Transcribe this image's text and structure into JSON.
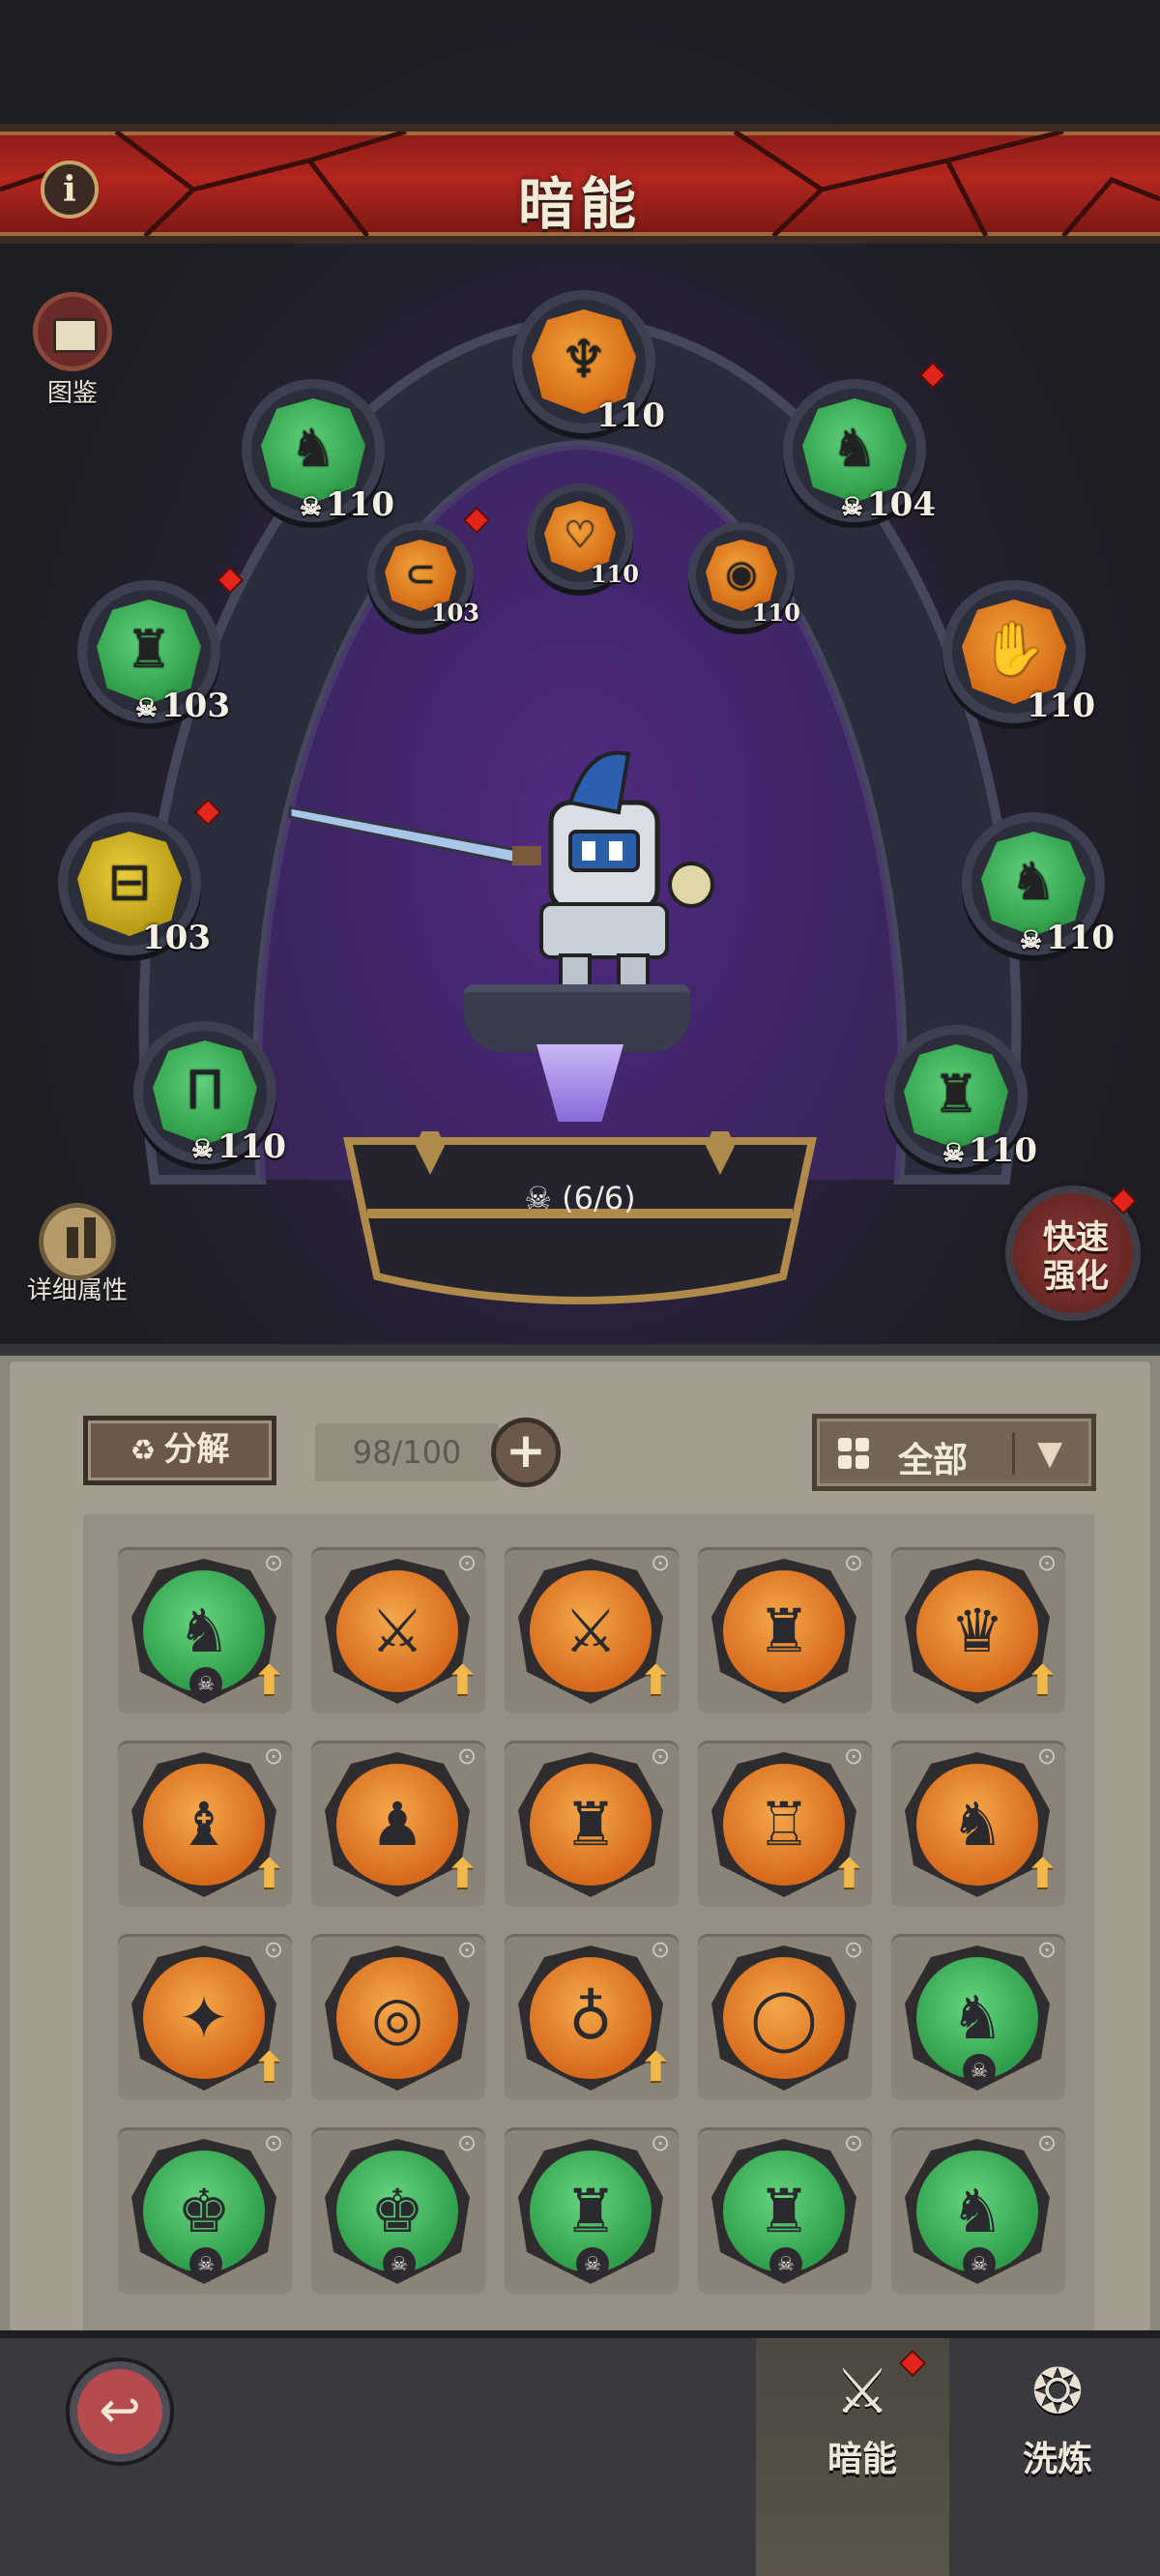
{
  "header": {
    "title": "暗能",
    "info_icon": "i"
  },
  "side_buttons": {
    "codex_label": "图鉴",
    "detail_label": "详细属性",
    "quick_label_line1": "快速",
    "quick_label_line2": "强化"
  },
  "equipped_slots": [
    {
      "name": "slot-top",
      "tier": "orange",
      "icon": "crossbow-icon",
      "level": "110",
      "has_skull": false
    },
    {
      "name": "slot-upper-left",
      "tier": "green",
      "icon": "helm-icon",
      "level": "110",
      "has_skull": true
    },
    {
      "name": "slot-upper-right",
      "tier": "green",
      "icon": "helm-icon",
      "level": "104",
      "has_skull": true
    },
    {
      "name": "slot-inner-left",
      "tier": "orange",
      "icon": "belt-icon",
      "level": "103",
      "has_skull": false
    },
    {
      "name": "slot-inner-center",
      "tier": "orange",
      "icon": "amulet-icon",
      "level": "110",
      "has_skull": false
    },
    {
      "name": "slot-inner-right",
      "tier": "orange",
      "icon": "ring-icon",
      "level": "110",
      "has_skull": false
    },
    {
      "name": "slot-mid-left",
      "tier": "green",
      "icon": "chest-icon",
      "level": "103",
      "has_skull": true
    },
    {
      "name": "slot-mid-right",
      "tier": "orange",
      "icon": "gauntlet-icon",
      "level": "110",
      "has_skull": false
    },
    {
      "name": "slot-low-left",
      "tier": "yellow",
      "icon": "bracer-icon",
      "level": "103",
      "has_skull": false
    },
    {
      "name": "slot-low-right",
      "tier": "green",
      "icon": "armor-icon",
      "level": "110",
      "has_skull": true
    },
    {
      "name": "slot-bottom-left",
      "tier": "green",
      "icon": "legs-icon",
      "level": "110",
      "has_skull": true
    },
    {
      "name": "slot-bottom-right",
      "tier": "green",
      "icon": "boots-icon",
      "level": "110",
      "has_skull": true
    }
  ],
  "set_count": "(6/6)",
  "inventory": {
    "decompose_label": "分解",
    "capacity": "98/100",
    "filter_label": "全部",
    "items": [
      {
        "tier": "green",
        "glyph": "♞",
        "badge": "☠",
        "upgrade": true
      },
      {
        "tier": "orange",
        "glyph": "⚔",
        "badge": "",
        "upgrade": true
      },
      {
        "tier": "orange",
        "glyph": "⚔",
        "badge": "",
        "upgrade": true
      },
      {
        "tier": "orange",
        "glyph": "♜",
        "badge": "",
        "upgrade": false
      },
      {
        "tier": "orange",
        "glyph": "♛",
        "badge": "",
        "upgrade": true
      },
      {
        "tier": "orange",
        "glyph": "♝",
        "badge": "",
        "upgrade": true
      },
      {
        "tier": "orange",
        "glyph": "♟",
        "badge": "",
        "upgrade": true
      },
      {
        "tier": "orange",
        "glyph": "♜",
        "badge": "",
        "upgrade": false
      },
      {
        "tier": "orange",
        "glyph": "♖",
        "badge": "",
        "upgrade": true
      },
      {
        "tier": "orange",
        "glyph": "♞",
        "badge": "",
        "upgrade": true
      },
      {
        "tier": "orange",
        "glyph": "✦",
        "badge": "",
        "upgrade": true
      },
      {
        "tier": "orange",
        "glyph": "◎",
        "badge": "",
        "upgrade": false
      },
      {
        "tier": "orange",
        "glyph": "♁",
        "badge": "",
        "upgrade": true
      },
      {
        "tier": "orange",
        "glyph": "◯",
        "badge": "",
        "upgrade": false
      },
      {
        "tier": "green",
        "glyph": "♞",
        "badge": "☠",
        "upgrade": false
      },
      {
        "tier": "green",
        "glyph": "♚",
        "badge": "☠",
        "upgrade": false
      },
      {
        "tier": "green",
        "glyph": "♚",
        "badge": "☠",
        "upgrade": false
      },
      {
        "tier": "green",
        "glyph": "♜",
        "badge": "☠",
        "upgrade": false
      },
      {
        "tier": "green",
        "glyph": "♜",
        "badge": "☠",
        "upgrade": false
      },
      {
        "tier": "green",
        "glyph": "♞",
        "badge": "☠",
        "upgrade": false
      }
    ]
  },
  "footer": {
    "tabs": [
      {
        "label": "暗能",
        "icon": "sword-emblem-icon",
        "active": true
      },
      {
        "label": "洗炼",
        "icon": "triple-ring-icon",
        "active": false
      }
    ]
  },
  "colors": {
    "accent_red": "#b2261f",
    "green_tier": "#2f9b48",
    "orange_tier": "#d46a16",
    "yellow_tier": "#b89a17"
  }
}
